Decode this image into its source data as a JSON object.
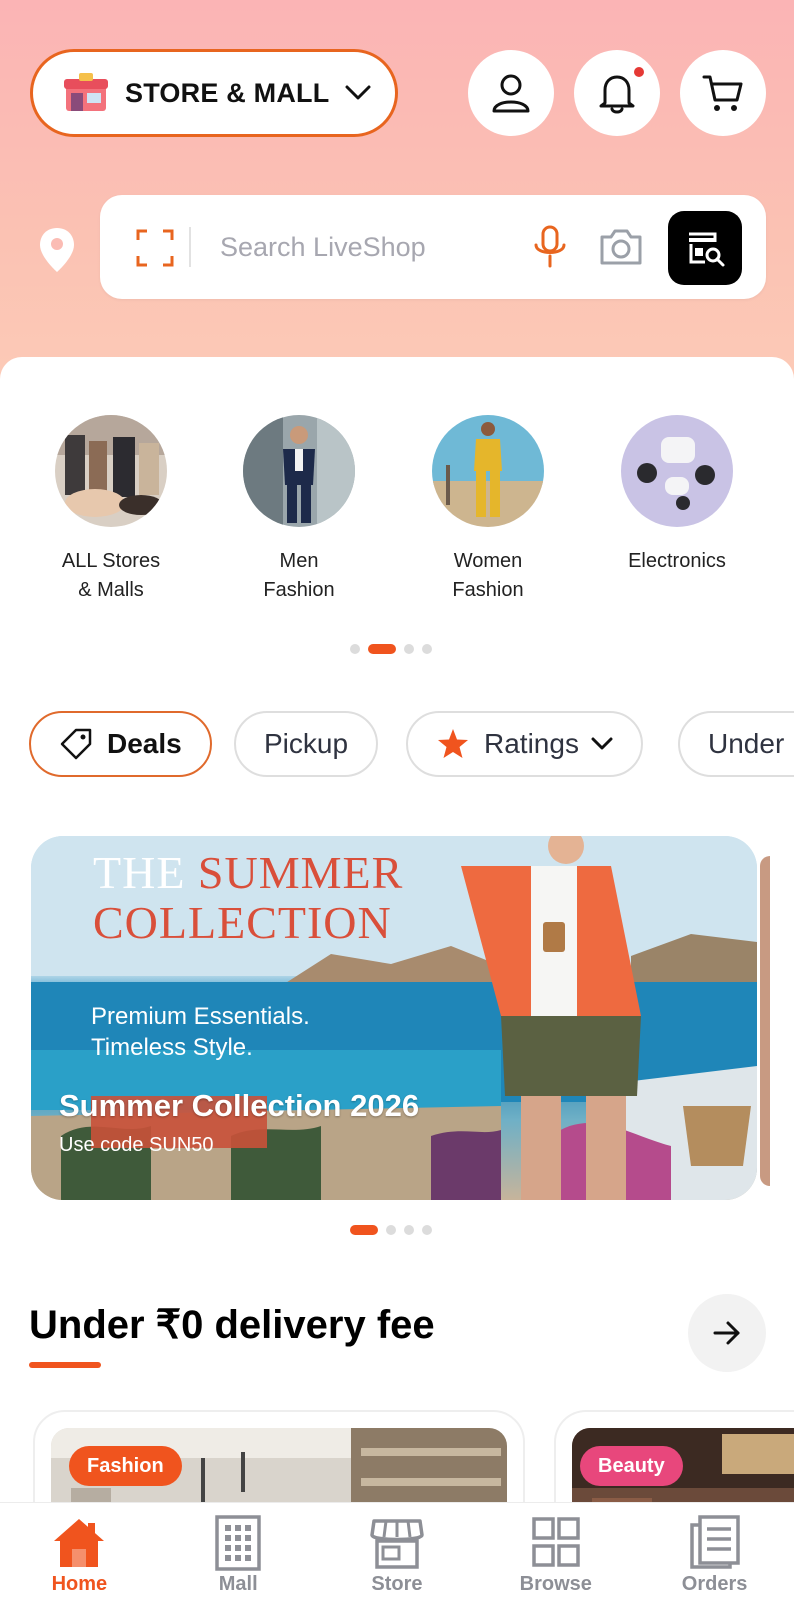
{
  "header": {
    "store_selector_label": "STORE & MALL"
  },
  "search": {
    "placeholder": "Search LiveShop"
  },
  "categories": [
    {
      "label": "ALL Stores\n& Malls"
    },
    {
      "label": "Men\nFashion"
    },
    {
      "label": "Women\nFashion"
    },
    {
      "label": "Electronics"
    }
  ],
  "filters": {
    "deals": "Deals",
    "pickup": "Pickup",
    "ratings": "Ratings",
    "under": "Under"
  },
  "banner": {
    "title_line1_a": "THE",
    "title_line1_b": "SUMMER",
    "title_line2": "COLLECTION",
    "subtitle_line1": "Premium Essentials.",
    "subtitle_line2": "Timeless Style.",
    "headline": "Summer Collection 2026",
    "code_text": "Use code SUN50"
  },
  "delivery_section": {
    "title": "Under ₹0 delivery fee",
    "cards": [
      {
        "badge": "Fashion",
        "badge_color": "#f0541e"
      },
      {
        "badge": "Beauty",
        "badge_color": "#e8477c"
      }
    ]
  },
  "bottom_nav": [
    {
      "label": "Home",
      "icon": "home-icon",
      "active": true
    },
    {
      "label": "Mall",
      "icon": "building-icon",
      "active": false
    },
    {
      "label": "Store",
      "icon": "storefront-icon",
      "active": false
    },
    {
      "label": "Browse",
      "icon": "grid-icon",
      "active": false
    },
    {
      "label": "Orders",
      "icon": "orders-icon",
      "active": false
    }
  ],
  "colors": {
    "accent": "#f0541e",
    "header_gradient_top": "#fbb4b5",
    "header_gradient_bottom": "#fccbb7"
  }
}
